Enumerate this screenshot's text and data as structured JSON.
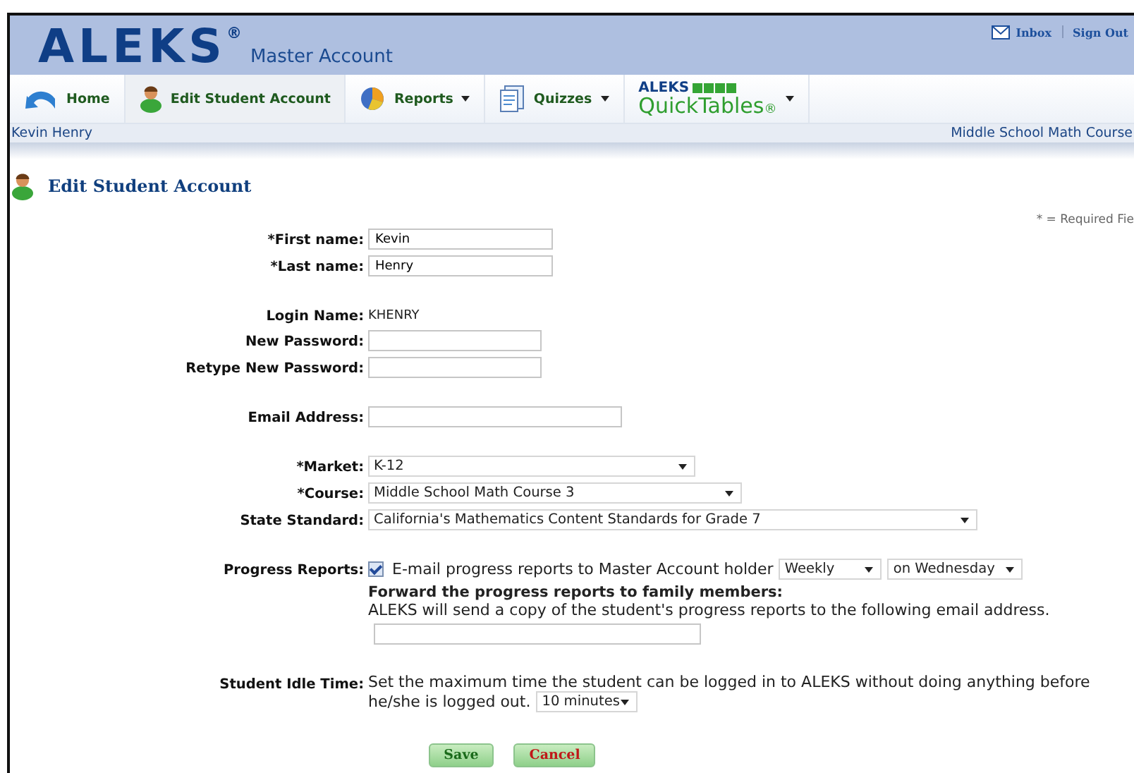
{
  "header": {
    "logo": "ALEKS",
    "logo_mark": "®",
    "subtitle": "Master Account",
    "links": [
      {
        "label": "Inbox"
      },
      {
        "label": "Sign Out"
      }
    ]
  },
  "nav": {
    "items": [
      {
        "kind": "link",
        "label": "Home",
        "selected": false,
        "dropdown": false
      },
      {
        "kind": "link",
        "label": "Edit Student Account",
        "selected": true,
        "dropdown": false
      },
      {
        "kind": "link",
        "label": "Reports",
        "selected": false,
        "dropdown": true
      },
      {
        "kind": "link",
        "label": "Quizzes",
        "selected": false,
        "dropdown": true
      },
      {
        "kind": "brand",
        "top": "ALEKS",
        "bottom": "QuickTables",
        "mark": "®",
        "selected": false,
        "dropdown": true
      }
    ]
  },
  "status_bar": {
    "student": "Kevin Henry",
    "course": "Middle School Math Course"
  },
  "page_title": "Edit Student Account",
  "required_note": "* = Required Fie",
  "sections": [
    [
      {
        "kind": "input",
        "label": "*First name:",
        "value": "Kevin"
      },
      {
        "kind": "input",
        "label": "*Last name:",
        "value": "Henry"
      }
    ],
    [
      {
        "kind": "static",
        "label": "Login Name:",
        "value": "KHENRY"
      },
      {
        "kind": "input",
        "label": "New Password:"
      },
      {
        "kind": "input",
        "label": "Retype New Password:"
      }
    ],
    [
      {
        "kind": "input",
        "label": "Email Address:"
      }
    ],
    [
      {
        "kind": "select",
        "label": "*Market:",
        "value": "K-12"
      },
      {
        "kind": "select",
        "label": "*Course:",
        "value": "Middle School Math Course 3"
      },
      {
        "kind": "select",
        "label": "State Standard:",
        "value": "California's Mathematics Content Standards for Grade 7"
      }
    ],
    [
      {
        "kind": "progress",
        "label": "Progress Reports:",
        "checked": true,
        "text": "E-mail progress reports to Master Account holder",
        "frequency": "Weekly",
        "day": "on Wednesday",
        "forward_heading": "Forward the progress reports to family members:",
        "forward_text": "ALEKS will send a copy of the student's progress reports to the following email address."
      }
    ],
    [
      {
        "kind": "idle",
        "label": "Student Idle Time:",
        "text": "Set the maximum time the student can be logged in to ALEKS without doing anything before",
        "text_end": "he/she is logged out.",
        "value": "10 minutes"
      }
    ]
  ],
  "buttons": [
    {
      "label": "Save",
      "kind": "save"
    },
    {
      "label": "Cancel",
      "kind": "cancel"
    }
  ]
}
